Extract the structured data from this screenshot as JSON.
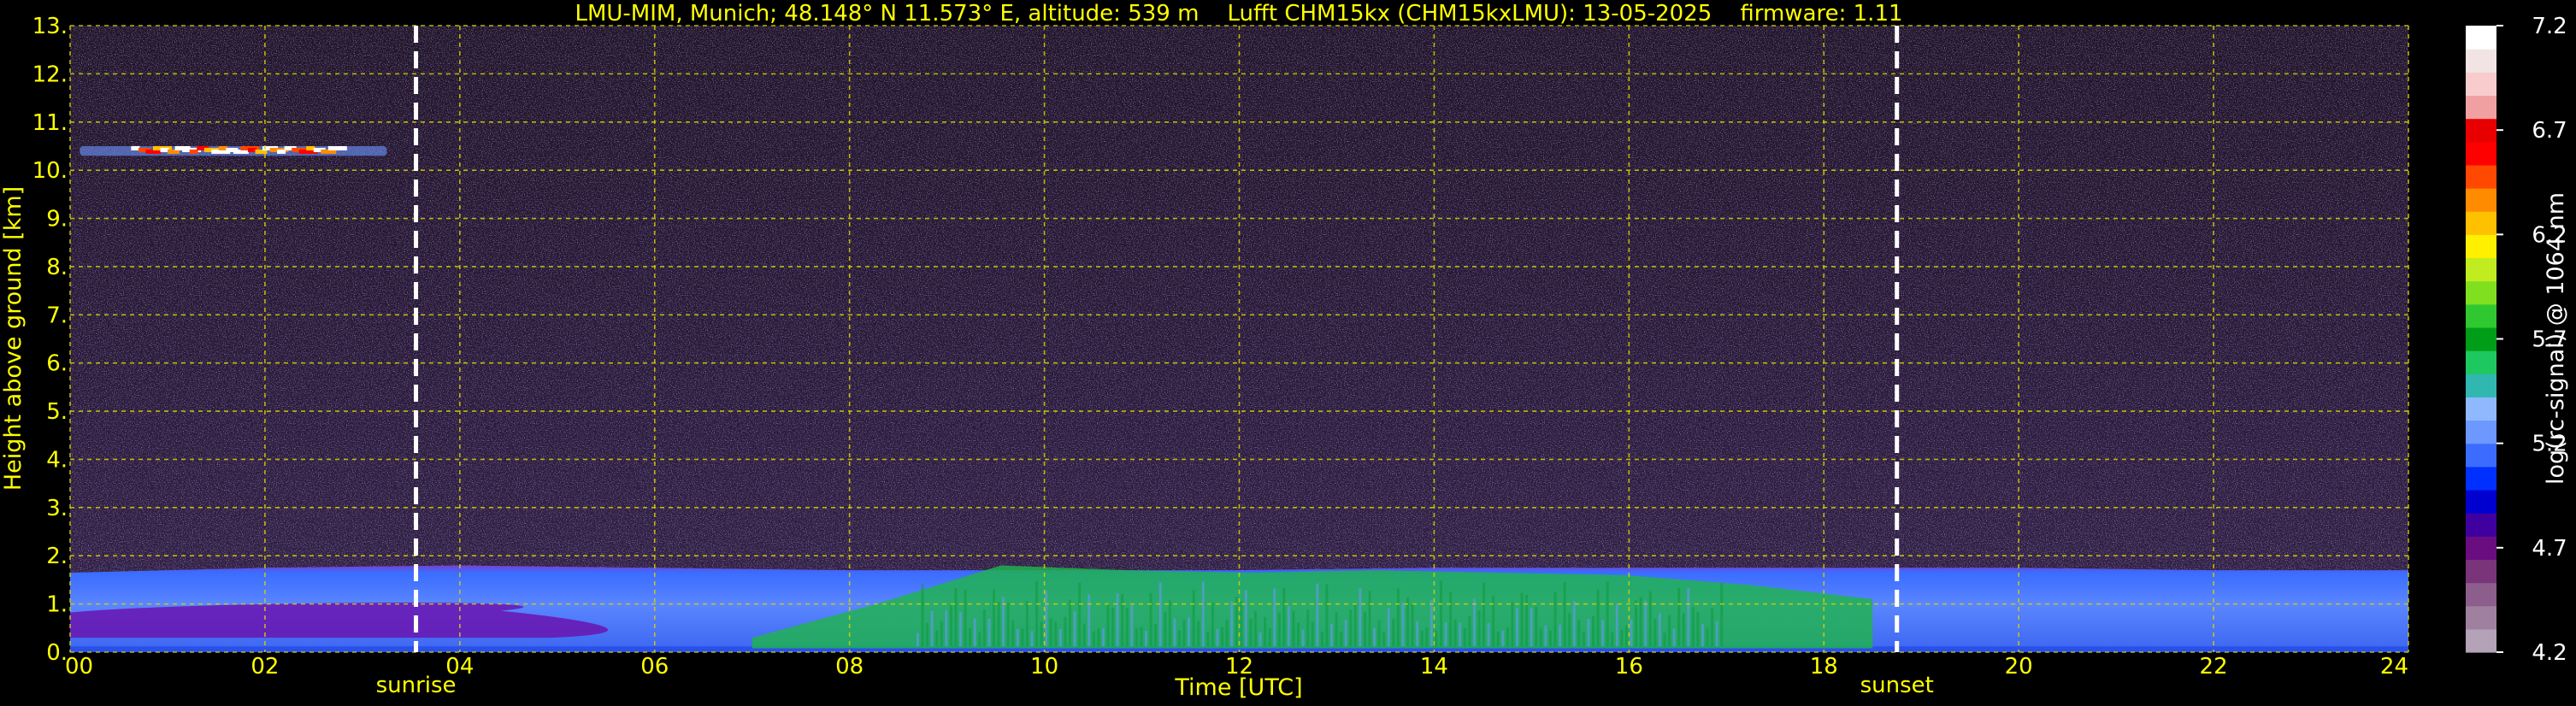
{
  "chart_data": {
    "type": "heatmap",
    "title": "LMU-MIM, Munich; 48.148° N 11.573° E, altitude: 539 m    Lufft CHM15kx (CHM15kxLMU): 13-05-2025    firmware: 1.11",
    "xlabel": "Time [UTC]",
    "ylabel": "Height above ground [km]",
    "xlim": [
      0,
      24
    ],
    "ylim": [
      0,
      13
    ],
    "x_ticks": [
      "00",
      "02",
      "04",
      "06",
      "08",
      "10",
      "12",
      "14",
      "16",
      "18",
      "20",
      "22",
      "24"
    ],
    "y_ticks": [
      "0.",
      "1.",
      "2.",
      "3.",
      "4.",
      "5.",
      "6.",
      "7.",
      "8.",
      "9.",
      "10.",
      "11.",
      "12.",
      "13."
    ],
    "grid": true,
    "colorbar": {
      "label": "log(rc-signal) @ 1064 nm",
      "range": [
        4.2,
        7.2
      ],
      "ticks": [
        "4.2",
        "4.7",
        "5.2",
        "5.7",
        "6.2",
        "6.7",
        "7.2"
      ],
      "colors": [
        "#b4a2b8",
        "#a0809f",
        "#8c5e8c",
        "#7a347a",
        "#6a0d80",
        "#4000a0",
        "#0000d0",
        "#0030ff",
        "#3c6cff",
        "#6c98ff",
        "#90b8ff",
        "#30b8b0",
        "#1ec860",
        "#009e18",
        "#30c830",
        "#80e020",
        "#c0ec20",
        "#fff000",
        "#ffc000",
        "#ff8c00",
        "#ff4800",
        "#ff0000",
        "#e80000",
        "#f0a0a0",
        "#f8cccc",
        "#f2e4e4",
        "#ffffff"
      ]
    },
    "events": [
      {
        "name": "sunrise",
        "x": 3.55
      },
      {
        "name": "sunset",
        "x": 18.75
      }
    ],
    "layers": [
      {
        "kind": "boundary_layer",
        "x": [
          0,
          24
        ],
        "top_km": [
          1.65,
          1.75,
          1.8,
          1.75,
          1.7,
          1.7,
          1.7,
          1.75,
          1.75,
          1.75,
          1.75,
          1.7,
          1.7
        ]
      },
      {
        "kind": "residual_layer_core",
        "x": [
          0,
          6
        ],
        "bottom_km": 0.3,
        "top_km": 1.0
      },
      {
        "kind": "mixed_layer_aerosol",
        "x": [
          7,
          18.5
        ],
        "top_km": [
          0.3,
          1.0,
          1.8,
          1.7,
          1.65,
          1.7,
          1.65,
          1.6,
          1.4,
          1.1
        ]
      },
      {
        "kind": "cirrus_cloud",
        "x": [
          0.1,
          3.25
        ],
        "bottom_km": 10.3,
        "top_km": 10.5
      }
    ]
  }
}
